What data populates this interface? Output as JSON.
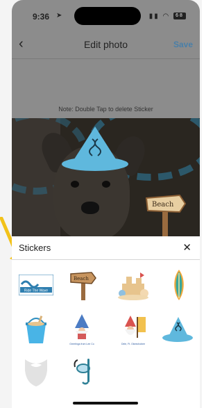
{
  "status_bar": {
    "time": "9:36",
    "battery": "68"
  },
  "nav": {
    "back": "‹",
    "title": "Edit photo",
    "save": "Save"
  },
  "note": "Note: Double Tap to delete Sticker",
  "photo": {
    "sign_text": "Beach"
  },
  "sheet": {
    "title": "Stickers",
    "close": "✕",
    "stickers": [
      {
        "name": "ride-the-wave-logo",
        "label": "Ride The Wave"
      },
      {
        "name": "beach-sign-sticker",
        "label": "Beach"
      },
      {
        "name": "sandcastle-sticker",
        "label": ""
      },
      {
        "name": "surfboard-sticker",
        "label": ""
      },
      {
        "name": "sand-bucket-sticker",
        "label": ""
      },
      {
        "name": "gnome-sticker",
        "label": "Greetings from Lee Co"
      },
      {
        "name": "gnome-flag-sticker",
        "label": "Dele, Ft. Okeechobee"
      },
      {
        "name": "wizard-hat-sticker",
        "label": ""
      },
      {
        "name": "beard-sticker",
        "label": ""
      },
      {
        "name": "snorkel-sticker",
        "label": ""
      }
    ]
  },
  "colors": {
    "accent": "#4a7fa8",
    "hat": "#5fb8dd",
    "arrow": "#f2c21a"
  }
}
